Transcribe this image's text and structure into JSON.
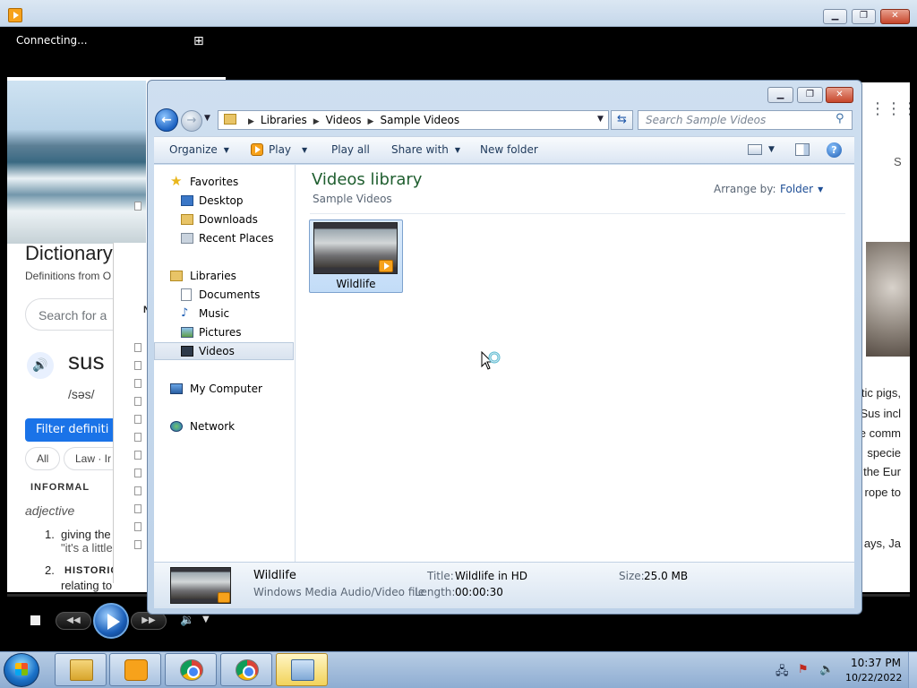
{
  "wmp": {
    "status": "Connecting...",
    "caption": {
      "minimize": "▁",
      "maximize": "❐",
      "close": "✕"
    }
  },
  "webpage": {
    "dict_title": "Dictionary",
    "dict_sub": "Definitions from O",
    "search_placeholder": "Search for a",
    "word": "sus",
    "phonetic": "/səs/",
    "filter_label": "Filter definiti",
    "chip_all": "All",
    "chip_law": "Law · Ir",
    "informal": "INFORMAL",
    "adjective": "adjective",
    "def1_num": "1.",
    "def1_line1": "giving the",
    "def1_line2": "\"it's a little",
    "def2_num": "2.",
    "def2_line1": "HISTORIC",
    "def2_line2": "relating to",
    "right_s": "S",
    "right_lines": [
      "tic pigs,",
      "Sus incl",
      "e comm",
      "specie",
      "the Eur",
      "rope to",
      "",
      "ays, Ja"
    ],
    "left_panel_letter": "N"
  },
  "explorer": {
    "caption": {
      "minimize": "▁",
      "maximize": "❐",
      "close": "✕"
    },
    "breadcrumbs": [
      "Libraries",
      "Videos",
      "Sample Videos"
    ],
    "search_placeholder": "Search Sample Videos",
    "toolbar": {
      "organize": "Organize",
      "play": "Play",
      "play_all": "Play all",
      "share_with": "Share with",
      "new_folder": "New folder"
    },
    "nav": {
      "favorites": "Favorites",
      "desktop": "Desktop",
      "downloads": "Downloads",
      "recent_places": "Recent Places",
      "libraries": "Libraries",
      "documents": "Documents",
      "music": "Music",
      "pictures": "Pictures",
      "videos": "Videos",
      "my_computer": "My Computer",
      "network": "Network"
    },
    "library_title": "Videos library",
    "library_sub": "Sample Videos",
    "arrange_by_label": "Arrange by:",
    "arrange_by_value": "Folder",
    "files": [
      {
        "name": "Wildlife"
      }
    ],
    "details": {
      "name": "Wildlife",
      "type": "Windows Media Audio/Video file",
      "title_label": "Title:",
      "title_value": "Wildlife in HD",
      "length_label": "Length:",
      "length_value": "00:00:30",
      "size_label": "Size:",
      "size_value": "25.0 MB"
    }
  },
  "taskbar": {
    "time": "10:37 PM",
    "date": "10/22/2022"
  }
}
